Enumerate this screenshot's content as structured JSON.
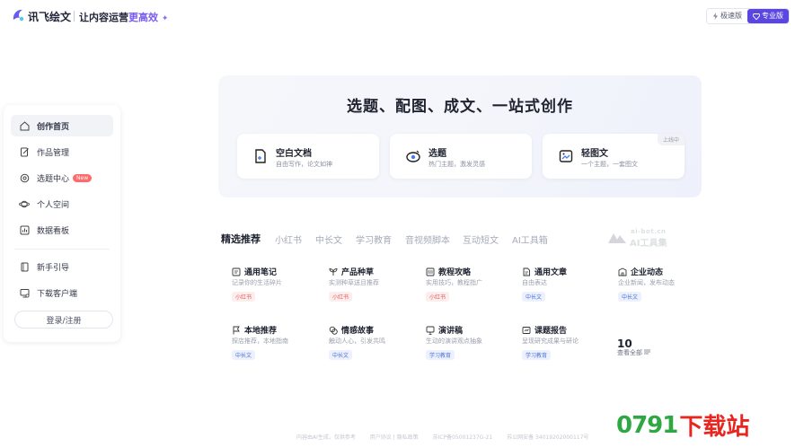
{
  "header": {
    "brand": "讯飞绘文",
    "slogan_prefix": "让内容运营",
    "slogan_highlight": "更高效",
    "slogan_spark": "✦",
    "version_basic": "极速版",
    "version_pro": "专业版"
  },
  "sidebar": {
    "items": [
      {
        "label": "创作首页",
        "icon": "home-icon"
      },
      {
        "label": "作品管理",
        "icon": "edit-doc-icon"
      },
      {
        "label": "选题中心",
        "icon": "target-icon",
        "badge": "New"
      },
      {
        "label": "个人空间",
        "icon": "planet-icon"
      },
      {
        "label": "数据看板",
        "icon": "chart-icon"
      },
      {
        "label": "新手引导",
        "icon": "book-icon"
      },
      {
        "label": "下载客户端",
        "icon": "download-icon"
      }
    ],
    "login": "登录/注册"
  },
  "hero": {
    "title": "选题、配图、成文、一站式创作",
    "cards": [
      {
        "title": "空白文档",
        "sub": "自由写作，论文如神",
        "icon": "blank-doc-icon"
      },
      {
        "title": "选题",
        "sub": "热门主题，激发灵感",
        "icon": "topic-eye-icon"
      },
      {
        "title": "轻图文",
        "sub": "一个主题，一套图文",
        "icon": "image-text-icon",
        "tag": "上线中"
      }
    ]
  },
  "tabs": [
    "精选推荐",
    "小红书",
    "中长文",
    "学习教育",
    "音视频脚本",
    "互动短文",
    "AI工具箱"
  ],
  "watermark_aibot": {
    "url": "ai-bot.cn",
    "name": "AI工具集"
  },
  "templates": [
    {
      "title": "通用笔记",
      "desc": "记录你的生活碎片",
      "tag": "小红书",
      "color": "red",
      "icon": "note-icon"
    },
    {
      "title": "产品种草",
      "desc": "实测种草送且推荐",
      "tag": "小红书",
      "color": "red",
      "icon": "sprout-icon"
    },
    {
      "title": "教程攻略",
      "desc": "实用技巧，教程指广",
      "tag": "小红书",
      "color": "red",
      "icon": "guide-icon"
    },
    {
      "title": "通用文章",
      "desc": "自由表达",
      "tag": "中长文",
      "color": "blue",
      "icon": "article-icon"
    },
    {
      "title": "企业动态",
      "desc": "企业新闻，发布动态",
      "tag": "中长文",
      "color": "blue",
      "icon": "building-icon"
    },
    {
      "title": "本地推荐",
      "desc": "探店推荐，本地指南",
      "tag": "中长文",
      "color": "blue",
      "icon": "flag-icon"
    },
    {
      "title": "情感故事",
      "desc": "触动人心，引发共鸣",
      "tag": "中长文",
      "color": "blue",
      "icon": "heart-story-icon"
    },
    {
      "title": "演讲稿",
      "desc": "生动的演讲观点抽象",
      "tag": "学习教育",
      "color": "blue",
      "icon": "speech-icon"
    },
    {
      "title": "课题报告",
      "desc": "呈现研究成果与研论",
      "tag": "学习教育",
      "color": "blue",
      "icon": "report-icon"
    }
  ],
  "more": {
    "count": "10",
    "label": "查看全部"
  },
  "footer": [
    "内容由AI生成，仅供参考",
    "用户协议 | 隐私政策",
    "苏ICP备05001237G-21",
    "苏公网安备 34019202000117号"
  ],
  "watermark791": {
    "digits": "0791",
    "text": "下载站"
  },
  "colors": {
    "accent": "#5b47e0",
    "highlight": "#7a5cf5",
    "tag_red": "#e25b5b",
    "tag_blue": "#4a72d8"
  }
}
